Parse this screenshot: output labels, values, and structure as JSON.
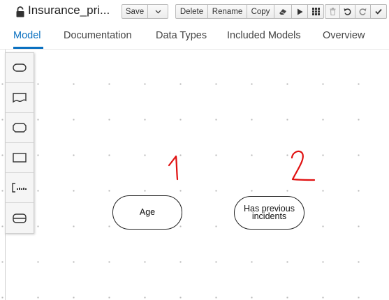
{
  "toolbar": {
    "title": "Insurance_pri...",
    "save_label": "Save",
    "delete_label": "Delete",
    "rename_label": "Rename",
    "copy_label": "Copy",
    "icons": [
      "lock-icon",
      "chevron-down-icon",
      "eraser-icon",
      "play-icon",
      "grid-icon",
      "trash-icon",
      "undo-icon",
      "redo-icon",
      "checkmark-icon"
    ]
  },
  "tabs": [
    {
      "label": "Model",
      "active": true
    },
    {
      "label": "Documentation",
      "active": false
    },
    {
      "label": "Data Types",
      "active": false
    },
    {
      "label": "Included Models",
      "active": false
    },
    {
      "label": "Overview",
      "active": false
    }
  ],
  "palette": {
    "items": [
      "decision-tool-icon",
      "input-data-tool-icon",
      "knowledge-source-tool-icon",
      "business-knowledge-model-tool-icon",
      "text-annotation-tool-icon",
      "decision-service-tool-icon"
    ]
  },
  "canvas": {
    "nodes": [
      {
        "label": "Age"
      },
      {
        "label": "Has previous incidents"
      }
    ],
    "annotations": [
      "1",
      "2"
    ],
    "annotation_color": "#e01010"
  },
  "colors": {
    "accent": "#0a70c0"
  }
}
